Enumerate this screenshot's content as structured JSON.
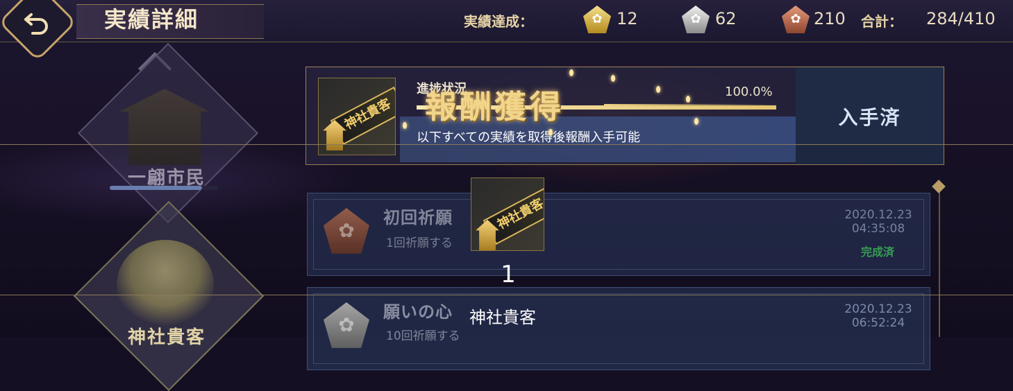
{
  "header": {
    "title": "実績詳細",
    "achievements_label": "実績達成：",
    "medals": [
      {
        "name": "gold",
        "count": "12"
      },
      {
        "name": "silver",
        "count": "62"
      },
      {
        "name": "bronze",
        "count": "210"
      }
    ],
    "total_label": "合計：",
    "total_value": "284/410"
  },
  "sidebar": {
    "categories": [
      {
        "label": "一翩市民",
        "progress": 0.85
      },
      {
        "label": "神社貴客"
      }
    ]
  },
  "reward": {
    "item_text": "神社貴客",
    "progress_label": "進捗状況",
    "progress_percent": "100.0%",
    "progress_value": 1.0,
    "description": "以下すべての実績を取得後報酬入手可能",
    "obtained_label": "入手済",
    "banner": "報酬獲得"
  },
  "achievements": [
    {
      "title": "初回祈願",
      "desc": "1回祈願する",
      "date": "2020.12.23",
      "time": "04:35:08",
      "status": "完成済",
      "medal": "bronze"
    },
    {
      "title": "願いの心",
      "desc": "10回祈願する",
      "date": "2020.12.23",
      "time": "06:52:24",
      "medal": "silver"
    }
  ],
  "popup": {
    "item_text": "神社貴客",
    "count": "1",
    "name": "神社貴客"
  },
  "colors": {
    "accent_gold": "#c6a46a",
    "complete_green": "#3aa65a",
    "obtained_text": "#d6e3f4"
  },
  "icons": {
    "back": "back-arrow-icon",
    "medal_flower": "sakura-icon"
  }
}
